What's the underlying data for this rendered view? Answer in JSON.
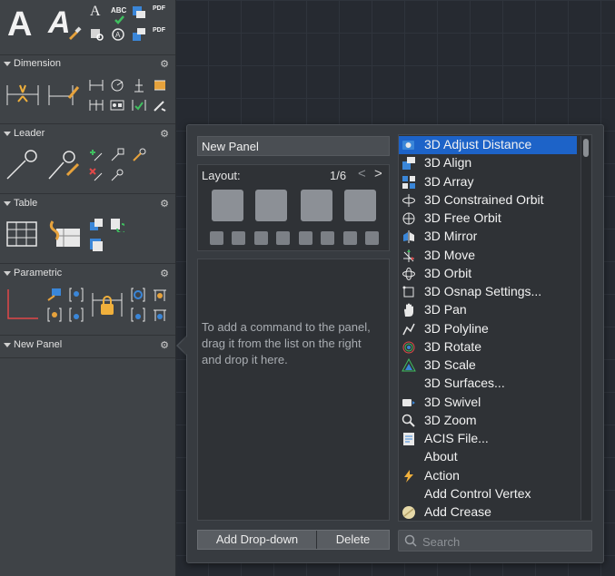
{
  "palette": {
    "sections": [
      {
        "title": "Dimension"
      },
      {
        "title": "Leader"
      },
      {
        "title": "Table"
      },
      {
        "title": "Parametric"
      },
      {
        "title": "New Panel"
      }
    ],
    "text_tools": {
      "big_a": "A",
      "styled_a": "A",
      "abc_label": "ABC",
      "pdf_label_1": "PDF",
      "pdf_label_2": "PDF"
    }
  },
  "popover": {
    "panel_name": "New Panel",
    "layout_label": "Layout:",
    "layout_page": "1/6",
    "nav_prev": "<",
    "nav_next": ">",
    "drop_hint": "To add a command to the panel, drag it from the list on the right and drop it here.",
    "add_dropdown_label": "Add Drop-down",
    "delete_label": "Delete",
    "search_placeholder": "Search",
    "commands": [
      {
        "label": "3D Adjust Distance",
        "icon": "camera-adjust-icon",
        "selected": true
      },
      {
        "label": "3D Align",
        "icon": "3d-align-icon"
      },
      {
        "label": "3D Array",
        "icon": "3d-array-icon"
      },
      {
        "label": "3D Constrained Orbit",
        "icon": "constrained-orbit-icon"
      },
      {
        "label": "3D Free Orbit",
        "icon": "free-orbit-icon"
      },
      {
        "label": "3D Mirror",
        "icon": "3d-mirror-icon"
      },
      {
        "label": "3D Move",
        "icon": "3d-move-icon"
      },
      {
        "label": "3D Orbit",
        "icon": "3d-orbit-icon"
      },
      {
        "label": "3D Osnap Settings...",
        "icon": "osnap-settings-icon"
      },
      {
        "label": "3D Pan",
        "icon": "hand-pan-icon"
      },
      {
        "label": "3D Polyline",
        "icon": "3d-polyline-icon"
      },
      {
        "label": "3D Rotate",
        "icon": "3d-rotate-icon"
      },
      {
        "label": "3D Scale",
        "icon": "3d-scale-icon"
      },
      {
        "label": "3D Surfaces...",
        "icon": ""
      },
      {
        "label": "3D Swivel",
        "icon": "camera-swivel-icon"
      },
      {
        "label": "3D Zoom",
        "icon": "magnifier-zoom-icon"
      },
      {
        "label": "ACIS File...",
        "icon": "acis-file-icon"
      },
      {
        "label": "About",
        "icon": ""
      },
      {
        "label": "Action",
        "icon": "lightning-action-icon"
      },
      {
        "label": "Add Control Vertex",
        "icon": ""
      },
      {
        "label": "Add Crease",
        "icon": "crease-icon"
      }
    ]
  },
  "colors": {
    "selection": "#1d63c8",
    "panel_bg": "#373b40",
    "palette_bg": "#3f4347"
  }
}
